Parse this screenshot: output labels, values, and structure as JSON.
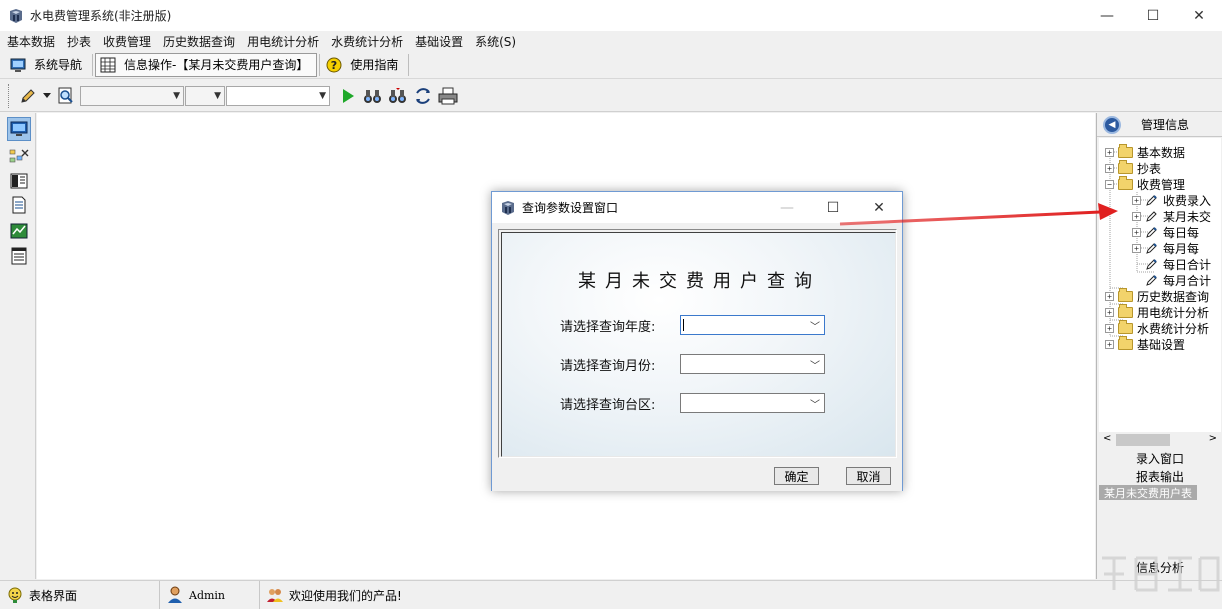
{
  "window": {
    "title": "水电费管理系统(非注册版)",
    "minimize": "—",
    "maximize": "☐",
    "close": "✕"
  },
  "menu": [
    "基本数据",
    "抄表",
    "收费管理",
    "历史数据查询",
    "用电统计分析",
    "水费统计分析",
    "基础设置",
    "系统(S)"
  ],
  "nav": {
    "system_nav": "系统导航",
    "info_op": "信息操作-【某月未交费用户查询】",
    "guide": "使用指南"
  },
  "right_panel": {
    "header": "管理信息",
    "tree": [
      {
        "label": "基本数据",
        "level": 0,
        "type": "folder",
        "expander": "+"
      },
      {
        "label": "抄表",
        "level": 0,
        "type": "folder",
        "expander": "+"
      },
      {
        "label": "收费管理",
        "level": 0,
        "type": "folder",
        "expander": "−"
      },
      {
        "label": "收费录入",
        "level": 1,
        "type": "item",
        "expander": "+"
      },
      {
        "label": "某月未交",
        "level": 1,
        "type": "item",
        "expander": "+"
      },
      {
        "label": "每日每",
        "level": 1,
        "type": "item",
        "expander": "+"
      },
      {
        "label": "每月每",
        "level": 1,
        "type": "item",
        "expander": "+"
      },
      {
        "label": "每日合计",
        "level": 1,
        "type": "item",
        "expander": ""
      },
      {
        "label": "每月合计",
        "level": 1,
        "type": "item",
        "expander": ""
      },
      {
        "label": "历史数据查询",
        "level": 0,
        "type": "folder",
        "expander": "+"
      },
      {
        "label": "用电统计分析",
        "level": 0,
        "type": "folder",
        "expander": "+"
      },
      {
        "label": "水费统计分析",
        "level": 0,
        "type": "folder",
        "expander": "+"
      },
      {
        "label": "基础设置",
        "level": 0,
        "type": "folder",
        "expander": "+"
      }
    ],
    "btn_entry": "录入窗口",
    "btn_report": "报表输出",
    "selected": "某月未交费用户表",
    "btn_analysis": "信息分析"
  },
  "status": {
    "view": "表格界面",
    "user": "Admin",
    "welcome": "欢迎使用我们的产品!"
  },
  "dialog": {
    "title": "查询参数设置窗口",
    "heading": "某月未交费用户查询",
    "year_label": "请选择查询年度:",
    "month_label": "请选择查询月份:",
    "area_label": "请选择查询台区:",
    "ok": "确定",
    "cancel": "取消"
  },
  "colors": {
    "accent": "#3b79cc",
    "arrow": "#e02020",
    "selection": "#9ec4ea"
  }
}
